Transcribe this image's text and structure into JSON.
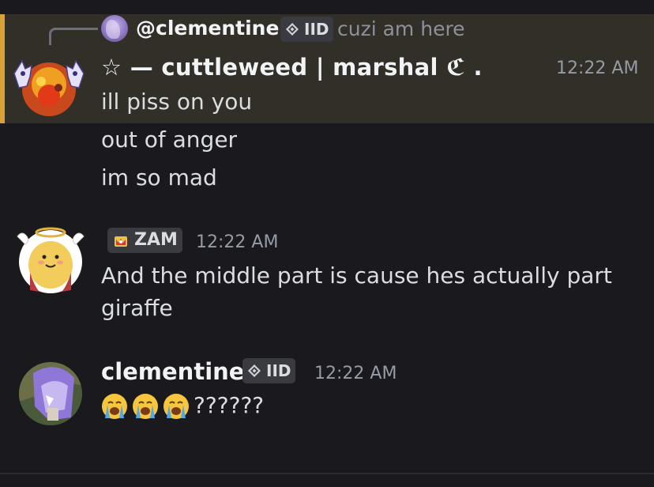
{
  "reply": {
    "name": "@clementine ;",
    "tag": "IID",
    "text": "cuzi am here"
  },
  "message1": {
    "author": "☆ — cuttleweed | marshal ℭ .",
    "timestamp": "12:22 AM",
    "lines": [
      "ill piss on you",
      "out of anger",
      "im so mad"
    ]
  },
  "message2": {
    "tag": "ZAM",
    "timestamp": "12:22 AM",
    "lines": [
      "And the middle part is cause hes actually part",
      "giraffe"
    ]
  },
  "message3": {
    "author": "clementine ;",
    "tag": "IID",
    "timestamp": "12:22 AM",
    "text": "??????"
  },
  "colors": {
    "highlight": "#322f29",
    "highlight_bar": "#d9a03a",
    "background": "#1a1a1e"
  }
}
